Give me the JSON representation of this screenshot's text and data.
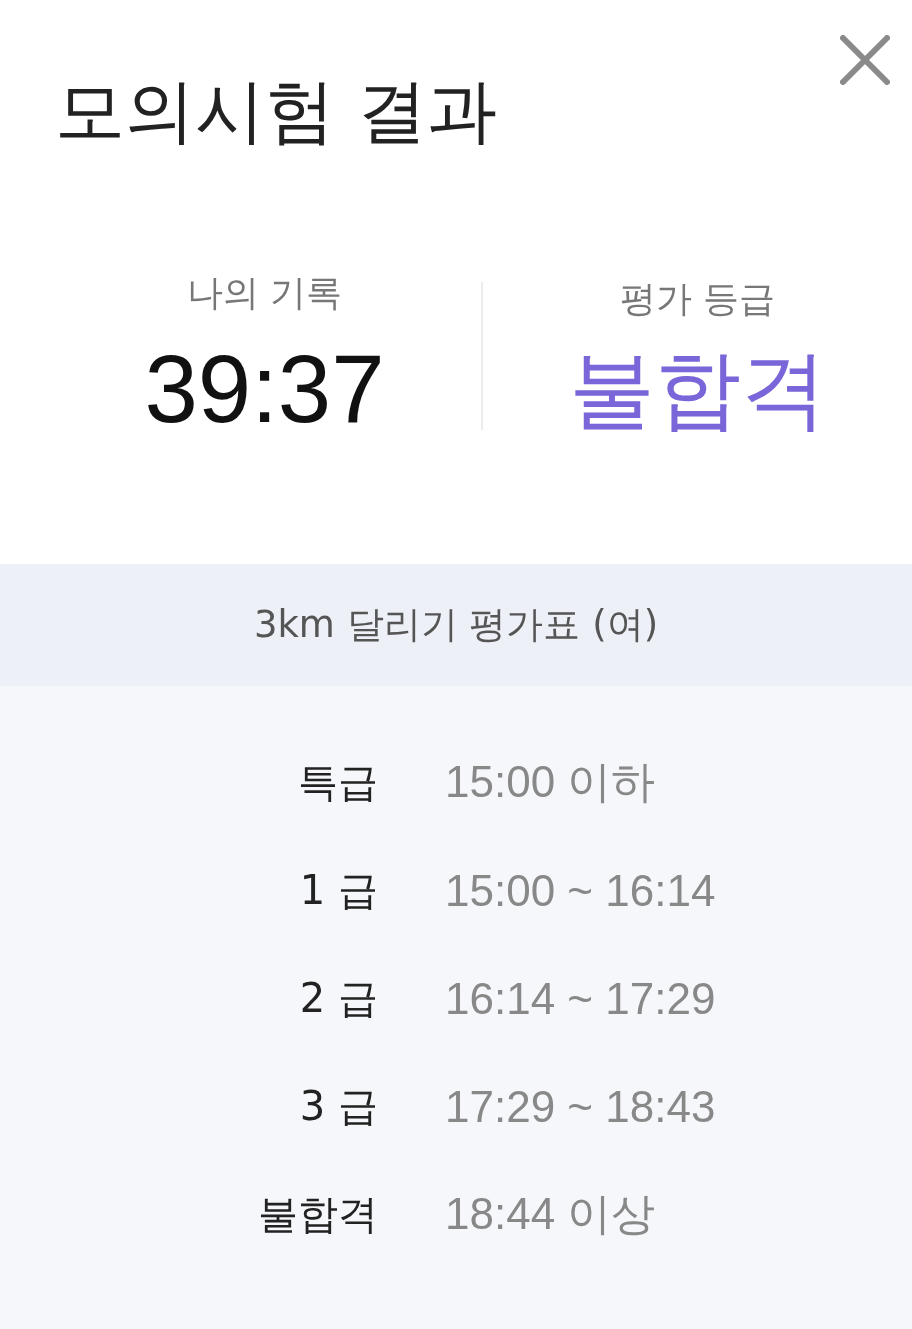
{
  "title": "모의시험 결과",
  "summary": [
    {
      "kind": "time",
      "label": "나의 기록",
      "value": "39:37"
    },
    {
      "kind": "grade",
      "label": "평가 등급",
      "value": "불합격"
    }
  ],
  "table": {
    "title": "3km 달리기 평가표 (여)",
    "rows": [
      {
        "grade": "특급",
        "range": "15:00 이하"
      },
      {
        "grade": "1 급",
        "range": "15:00 ~ 16:14"
      },
      {
        "grade": "2 급",
        "range": "16:14 ~ 17:29"
      },
      {
        "grade": "3 급",
        "range": "17:29 ~ 18:43"
      },
      {
        "grade": "불합격",
        "range": "18:44 이상"
      }
    ]
  }
}
